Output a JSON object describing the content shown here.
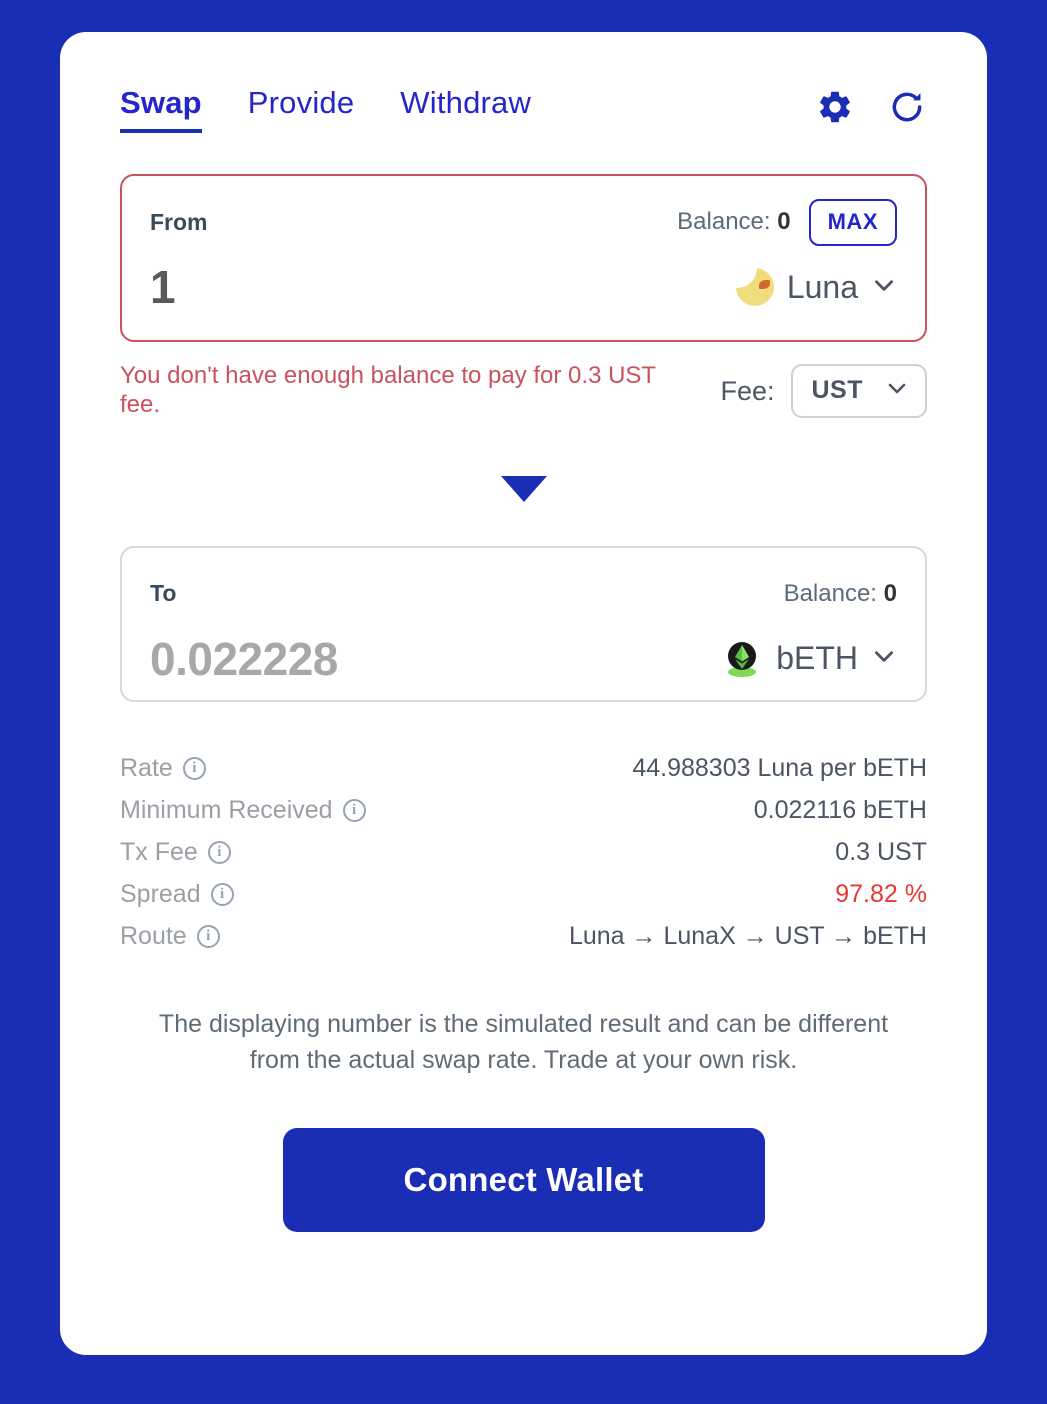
{
  "theme": {
    "page_background": "#1a2db5",
    "card_background": "#ffffff",
    "accent": "#1a2db5",
    "link_blue": "#2525cc",
    "error_red": "#c9525c",
    "danger_red": "#e53935",
    "muted_gray": "#9b9fa6",
    "border_gray": "#d8d8d8"
  },
  "tabs": [
    {
      "label": "Swap",
      "active": true,
      "name": "tab-swap"
    },
    {
      "label": "Provide",
      "active": false,
      "name": "tab-provide"
    },
    {
      "label": "Withdraw",
      "active": false,
      "name": "tab-withdraw"
    }
  ],
  "tab_actions": [
    {
      "icon": "gear-icon"
    },
    {
      "icon": "refresh-icon"
    }
  ],
  "from": {
    "label": "From",
    "balance_label": "Balance:",
    "balance_value": "0",
    "max_label": "MAX",
    "amount": "1",
    "amount_placeholder": "0",
    "token": "Luna",
    "token_icon": "luna-token-icon",
    "chevron": "chevron-down-icon"
  },
  "error": {
    "message": "You don't have enough balance to pay for 0.3 UST fee.",
    "fee_label": "Fee:",
    "fee_currency": "UST",
    "fee_chevron": "chevron-down-icon"
  },
  "direction": {
    "icon": "arrow-down-icon"
  },
  "to": {
    "label": "To",
    "balance_label": "Balance:",
    "balance_value": "0",
    "amount": "0.022228",
    "amount_placeholder": "0",
    "token": "bETH",
    "token_icon": "beth-token-icon",
    "chevron": "chevron-down-icon"
  },
  "details": [
    {
      "label": "Rate",
      "value": "44.988303 Luna per bETH",
      "danger": false,
      "name": "detail-row-rate"
    },
    {
      "label": "Minimum Received",
      "value": "0.022116 bETH",
      "danger": false,
      "name": "detail-row-minimum-received"
    },
    {
      "label": "Tx Fee",
      "value": "0.3 UST",
      "danger": false,
      "name": "detail-row-tx-fee"
    },
    {
      "label": "Spread",
      "value": "97.82 %",
      "danger": true,
      "name": "detail-row-spread"
    },
    {
      "label": "Route",
      "value": "Luna → LunaX → UST → bETH",
      "danger": false,
      "name": "detail-row-route"
    }
  ],
  "disclaimer": "The displaying number is the simulated result and can be different from the actual swap rate. Trade at your own risk.",
  "connect": {
    "label": "Connect Wallet"
  }
}
